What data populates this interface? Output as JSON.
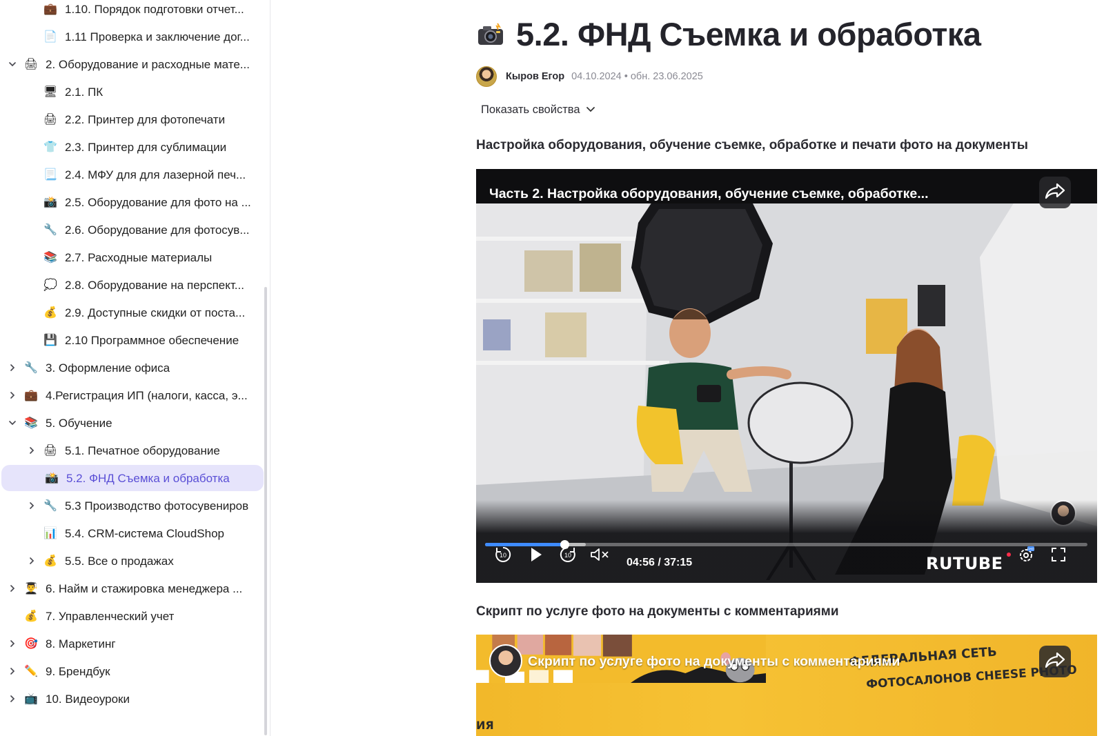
{
  "sidebar": {
    "items": [
      {
        "label": "1.10. Порядок подготовки отчет...",
        "icon": "briefcase-icon",
        "emoji": "💼",
        "level": 1,
        "chevron": "none"
      },
      {
        "label": "1.11 Проверка и заключение дог...",
        "icon": "document-icon",
        "emoji": "📄",
        "level": 1,
        "chevron": "none"
      },
      {
        "label": "2. Оборудование и расходные мате...",
        "icon": "printer-icon",
        "emoji": "🖨",
        "level": 0,
        "chevron": "down"
      },
      {
        "label": "2.1. ПК",
        "icon": "desktop-icon",
        "emoji": "🖥",
        "level": 1,
        "chevron": "none"
      },
      {
        "label": "2.2. Принтер для фотопечати",
        "icon": "printer-icon",
        "emoji": "🖨",
        "level": 1,
        "chevron": "none"
      },
      {
        "label": "2.3. Принтер для сублимации",
        "icon": "tshirt-icon",
        "emoji": "👕",
        "level": 1,
        "chevron": "none"
      },
      {
        "label": "2.4. МФУ для для лазерной печ...",
        "icon": "paper-icon",
        "emoji": "📃",
        "level": 1,
        "chevron": "none"
      },
      {
        "label": "2.5. Оборудование для фото на ...",
        "icon": "camera-flash-icon",
        "emoji": "📸",
        "level": 1,
        "chevron": "none"
      },
      {
        "label": "2.6. Оборудование для фотосув...",
        "icon": "wrench-icon",
        "emoji": "🔧",
        "level": 1,
        "chevron": "none"
      },
      {
        "label": "2.7. Расходные материалы",
        "icon": "books-icon",
        "emoji": "📚",
        "level": 1,
        "chevron": "none"
      },
      {
        "label": "2.8. Оборудование на перспект...",
        "icon": "thought-bubble-icon",
        "emoji": "💭",
        "level": 1,
        "chevron": "none"
      },
      {
        "label": "2.9. Доступные скидки от поста...",
        "icon": "money-bag-icon",
        "emoji": "💰",
        "level": 1,
        "chevron": "none"
      },
      {
        "label": "2.10 Программное обеспечение",
        "icon": "floppy-disk-icon",
        "emoji": "💾",
        "level": 1,
        "chevron": "none"
      },
      {
        "label": "3. Оформление офиса",
        "icon": "wrench-icon",
        "emoji": "🔧",
        "level": 0,
        "chevron": "right"
      },
      {
        "label": "4.Регистрация ИП (налоги, касса, э...",
        "icon": "briefcase-icon",
        "emoji": "💼",
        "level": 0,
        "chevron": "right"
      },
      {
        "label": "5. Обучение",
        "icon": "books-icon",
        "emoji": "📚",
        "level": 0,
        "chevron": "down"
      },
      {
        "label": "5.1. Печатное оборудование",
        "icon": "printer-icon",
        "emoji": "🖨",
        "level": 1,
        "chevron": "right"
      },
      {
        "label": "5.2. ФНД Съемка и обработка",
        "icon": "camera-flash-icon",
        "emoji": "📸",
        "level": 1,
        "chevron": "none",
        "active": true
      },
      {
        "label": "5.3 Производство фотосувениров",
        "icon": "wrench-icon",
        "emoji": "🔧",
        "level": 1,
        "chevron": "right"
      },
      {
        "label": "5.4. CRM-система CloudShop",
        "icon": "bar-chart-icon",
        "emoji": "📊",
        "level": 1,
        "chevron": "none"
      },
      {
        "label": "5.5. Все о продажах",
        "icon": "money-bag-icon",
        "emoji": "💰",
        "level": 1,
        "chevron": "right"
      },
      {
        "label": "6. Найм и стажировка менеджера ...",
        "icon": "student-icon",
        "emoji": "👨‍🎓",
        "level": 0,
        "chevron": "right"
      },
      {
        "label": "7. Управленческий учет",
        "icon": "money-bag-icon",
        "emoji": "💰",
        "level": 0,
        "chevron": "none"
      },
      {
        "label": "8. Маркетинг",
        "icon": "target-icon",
        "emoji": "🎯",
        "level": 0,
        "chevron": "right"
      },
      {
        "label": "9. Брендбук",
        "icon": "pencil-icon",
        "emoji": "✏️",
        "level": 0,
        "chevron": "right"
      },
      {
        "label": "10. Видеоуроки",
        "icon": "tv-icon",
        "emoji": "📺",
        "level": 0,
        "chevron": "right"
      }
    ]
  },
  "page": {
    "title": "5.2. ФНД Съемка и обработка",
    "title_icon": "camera-flash-icon",
    "author": "Кыров Егор",
    "dates": "04.10.2024 • обн. 23.06.2025",
    "props_toggle": "Показать свойства",
    "section1_heading": "Настройка оборудования, обучение съемке, обработке и печати фото на документы",
    "section2_heading": "Скрипт по услуге фото на документы с комментариями"
  },
  "video1": {
    "title": "Часть 2. Настройка оборудования, обучение съемке, обработке...",
    "time": "04:56 / 37:15",
    "brand": "RUTUBE",
    "progress": 0.132,
    "buffered": 0.167
  },
  "video2": {
    "title": "Скрипт по услуге фото на документы с комментариями",
    "wall_text_1": "ФЕДЕРАЛЬНАЯ СЕТЬ",
    "wall_text_2": "ФОТОСАЛОНОВ CHEESE PHOTO",
    "wall_text_3": "ИЯ"
  },
  "colors": {
    "accent": "#5a4fd6",
    "active_bg": "#e6e4fb",
    "progress": "#3e8bff",
    "video2_bg": "#f4bd2e"
  }
}
